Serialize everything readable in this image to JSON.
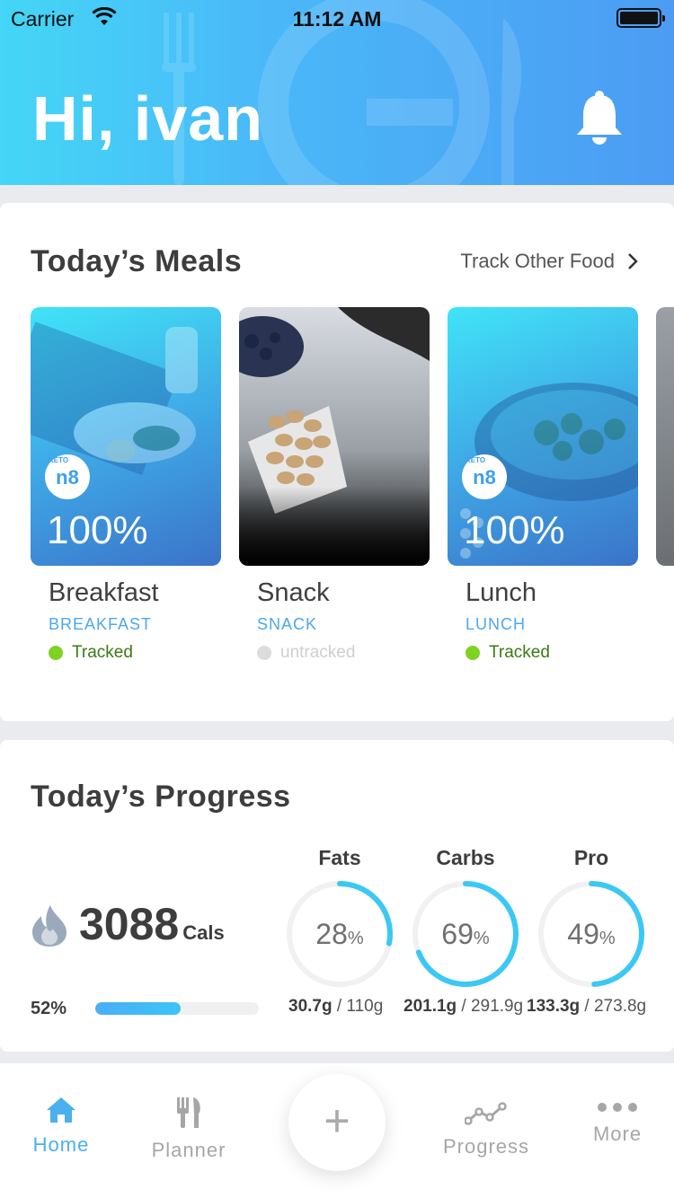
{
  "status_bar": {
    "carrier": "Carrier",
    "time": "11:12 AM"
  },
  "header": {
    "greeting": "Hi, ivan"
  },
  "meals": {
    "title": "Today’s Meals",
    "track_other": "Track Other Food",
    "items": [
      {
        "percent": "100%",
        "name": "Breakfast",
        "type": "BREAKFAST",
        "status": "Tracked"
      },
      {
        "percent": "",
        "name": "Snack",
        "type": "SNACK",
        "status": "untracked"
      },
      {
        "percent": "100%",
        "name": "Lunch",
        "type": "LUNCH",
        "status": "Tracked"
      }
    ],
    "badge_top": "KETO",
    "badge_main": "n8"
  },
  "progress": {
    "title": "Today’s Progress",
    "calories": "3088",
    "cal_unit": "Cals",
    "percent_label": "52%",
    "percent_value": 0.52,
    "macros": [
      {
        "name": "Fats",
        "value": "28",
        "unit": "%",
        "fraction": 0.28,
        "consumed": "30.7g",
        "total": " / 110g"
      },
      {
        "name": "Carbs",
        "value": "69",
        "unit": "%",
        "fraction": 0.69,
        "consumed": "201.1g",
        "total": " / 291.9g"
      },
      {
        "name": "Pro",
        "value": "49",
        "unit": "%",
        "fraction": 0.49,
        "consumed": "133.3g",
        "total": " / 273.8g"
      }
    ]
  },
  "tabbar": {
    "home": "Home",
    "planner": "Planner",
    "add": "+",
    "progress": "Progress",
    "more": "More"
  },
  "colors": {
    "accent": "#4ab0f0",
    "tracked": "#7ed321",
    "untracked": "#dcdcdc",
    "ring": "#3cc8f4"
  }
}
